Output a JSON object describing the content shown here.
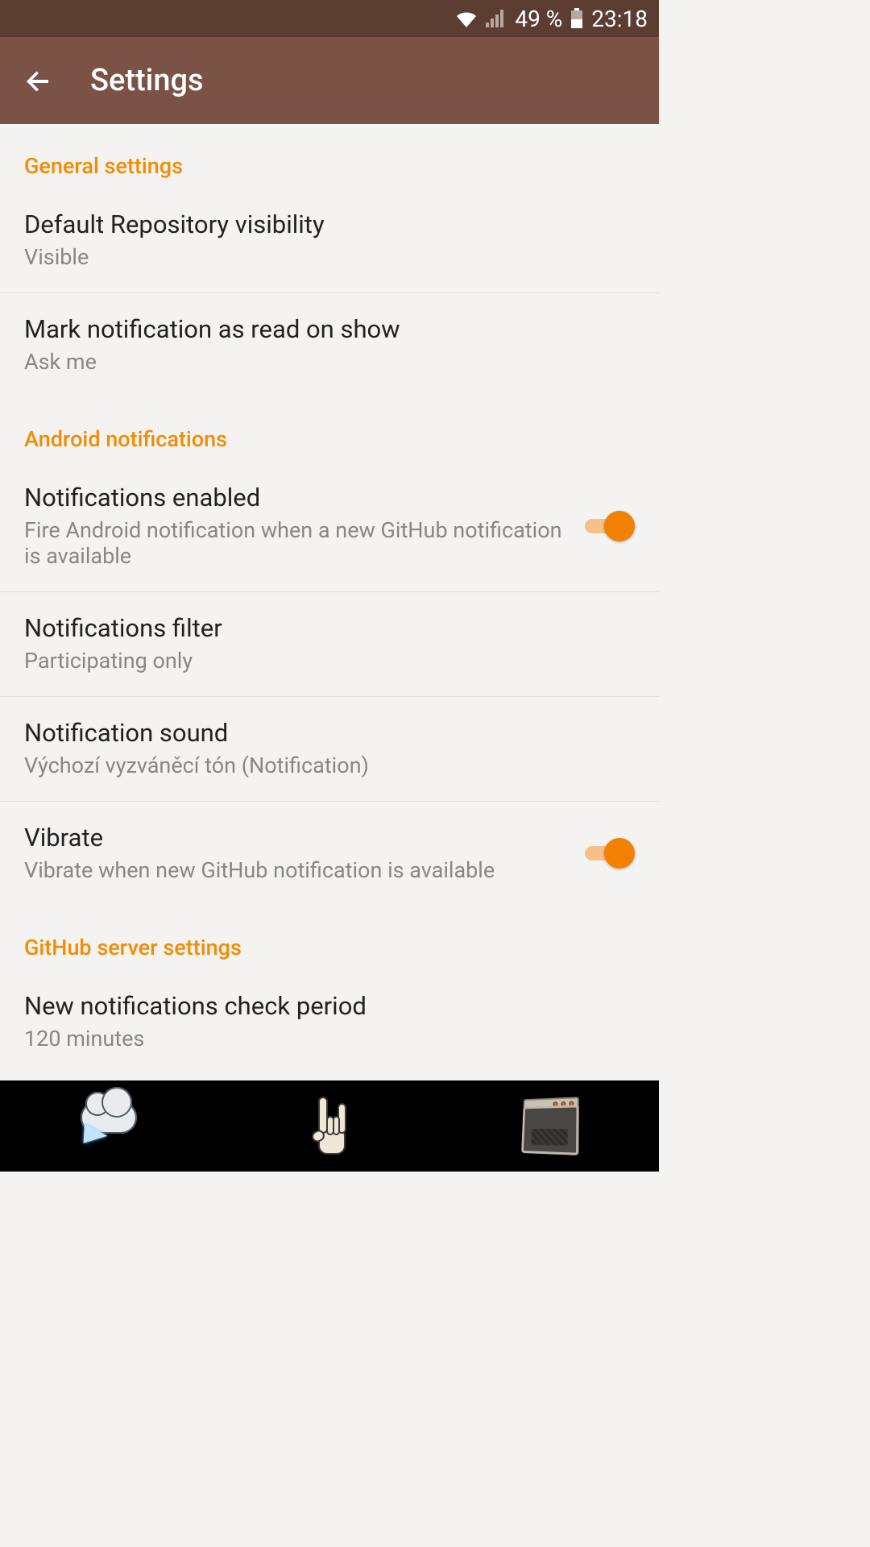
{
  "statusbar": {
    "wifi_icon": "wifi-icon",
    "cell_icon": "cell-signal-icon",
    "battery_pct": "49 %",
    "battery_icon": "battery-icon",
    "time": "23:18"
  },
  "appbar": {
    "back_icon": "arrow-left-icon",
    "title": "Settings"
  },
  "sections": {
    "general": {
      "header": "General settings",
      "items": [
        {
          "title": "Default Repository visibility",
          "sub": "Visible"
        },
        {
          "title": "Mark notification as read on show",
          "sub": "Ask me"
        }
      ]
    },
    "android": {
      "header": "Android notifications",
      "items": [
        {
          "title": "Notifications enabled",
          "sub": "Fire Android notification when a new GitHub notification is available",
          "switch": true
        },
        {
          "title": "Notifications filter",
          "sub": "Participating only"
        },
        {
          "title": "Notification sound",
          "sub": "Výchozí vyzváněcí tón (Notification)"
        },
        {
          "title": "Vibrate",
          "sub": "Vibrate when new GitHub notification is available",
          "switch": true
        }
      ]
    },
    "server": {
      "header": "GitHub server settings",
      "items": [
        {
          "title": "New notifications check period",
          "sub": "120 minutes"
        }
      ]
    }
  },
  "navbar": {
    "back_icon": "cloud-lightning-icon",
    "home_icon": "rock-hand-icon",
    "recents_icon": "amp-icon"
  }
}
